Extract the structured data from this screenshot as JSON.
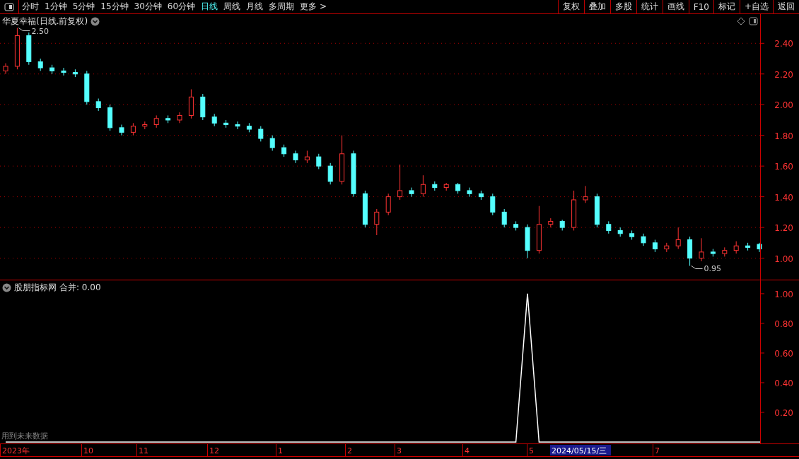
{
  "toolbar": {
    "periods": [
      {
        "label": "分时",
        "selected": false
      },
      {
        "label": "1分钟",
        "selected": false
      },
      {
        "label": "5分钟",
        "selected": false
      },
      {
        "label": "15分钟",
        "selected": false
      },
      {
        "label": "30分钟",
        "selected": false
      },
      {
        "label": "60分钟",
        "selected": false
      },
      {
        "label": "日线",
        "selected": true
      },
      {
        "label": "周线",
        "selected": false
      },
      {
        "label": "月线",
        "selected": false
      },
      {
        "label": "多周期",
        "selected": false
      },
      {
        "label": "更多 >",
        "selected": false
      }
    ],
    "buttons": [
      "复权",
      "叠加",
      "多股",
      "统计",
      "画线",
      "F10",
      "标记",
      "+自选",
      "返回"
    ]
  },
  "price_pane": {
    "title": "华夏幸福(日线.前复权)",
    "chart_data": {
      "type": "candlestick",
      "grid": true,
      "ohlc": [
        [
          2.22,
          2.27,
          2.2,
          2.25
        ],
        [
          2.25,
          2.5,
          2.23,
          2.45
        ],
        [
          2.45,
          2.47,
          2.26,
          2.28
        ],
        [
          2.28,
          2.3,
          2.22,
          2.24
        ],
        [
          2.24,
          2.26,
          2.2,
          2.22
        ],
        [
          2.22,
          2.24,
          2.19,
          2.21
        ],
        [
          2.21,
          2.23,
          2.18,
          2.2
        ],
        [
          2.2,
          2.22,
          2.0,
          2.02
        ],
        [
          2.02,
          2.04,
          1.96,
          1.98
        ],
        [
          1.98,
          2.0,
          1.83,
          1.85
        ],
        [
          1.85,
          1.87,
          1.8,
          1.82
        ],
        [
          1.82,
          1.88,
          1.8,
          1.86
        ],
        [
          1.86,
          1.89,
          1.84,
          1.87
        ],
        [
          1.87,
          1.93,
          1.85,
          1.91
        ],
        [
          1.91,
          1.93,
          1.88,
          1.9
        ],
        [
          1.9,
          1.95,
          1.88,
          1.93
        ],
        [
          1.93,
          2.1,
          1.91,
          2.05
        ],
        [
          2.05,
          2.07,
          1.9,
          1.92
        ],
        [
          1.92,
          1.94,
          1.86,
          1.88
        ],
        [
          1.88,
          1.9,
          1.85,
          1.87
        ],
        [
          1.87,
          1.89,
          1.84,
          1.86
        ],
        [
          1.86,
          1.88,
          1.82,
          1.84
        ],
        [
          1.84,
          1.86,
          1.76,
          1.78
        ],
        [
          1.78,
          1.8,
          1.7,
          1.72
        ],
        [
          1.72,
          1.74,
          1.66,
          1.68
        ],
        [
          1.68,
          1.7,
          1.62,
          1.64
        ],
        [
          1.64,
          1.7,
          1.62,
          1.66
        ],
        [
          1.66,
          1.68,
          1.58,
          1.6
        ],
        [
          1.6,
          1.62,
          1.48,
          1.5
        ],
        [
          1.5,
          1.8,
          1.48,
          1.68
        ],
        [
          1.68,
          1.7,
          1.4,
          1.42
        ],
        [
          1.42,
          1.44,
          1.2,
          1.22
        ],
        [
          1.22,
          1.32,
          1.15,
          1.3
        ],
        [
          1.3,
          1.42,
          1.28,
          1.4
        ],
        [
          1.4,
          1.61,
          1.38,
          1.44
        ],
        [
          1.44,
          1.46,
          1.4,
          1.42
        ],
        [
          1.42,
          1.54,
          1.4,
          1.48
        ],
        [
          1.48,
          1.5,
          1.44,
          1.46
        ],
        [
          1.46,
          1.49,
          1.44,
          1.48
        ],
        [
          1.48,
          1.49,
          1.42,
          1.44
        ],
        [
          1.44,
          1.46,
          1.4,
          1.42
        ],
        [
          1.42,
          1.44,
          1.38,
          1.4
        ],
        [
          1.4,
          1.42,
          1.28,
          1.3
        ],
        [
          1.3,
          1.32,
          1.2,
          1.22
        ],
        [
          1.22,
          1.24,
          1.18,
          1.2
        ],
        [
          1.2,
          1.22,
          1.0,
          1.05
        ],
        [
          1.05,
          1.34,
          1.03,
          1.22
        ],
        [
          1.22,
          1.26,
          1.2,
          1.24
        ],
        [
          1.24,
          1.25,
          1.18,
          1.2
        ],
        [
          1.2,
          1.44,
          1.18,
          1.38
        ],
        [
          1.38,
          1.47,
          1.36,
          1.4
        ],
        [
          1.4,
          1.42,
          1.2,
          1.22
        ],
        [
          1.22,
          1.24,
          1.16,
          1.18
        ],
        [
          1.18,
          1.2,
          1.14,
          1.16
        ],
        [
          1.16,
          1.18,
          1.12,
          1.14
        ],
        [
          1.14,
          1.16,
          1.08,
          1.1
        ],
        [
          1.1,
          1.12,
          1.04,
          1.06
        ],
        [
          1.06,
          1.1,
          1.04,
          1.08
        ],
        [
          1.08,
          1.2,
          1.06,
          1.12
        ],
        [
          1.12,
          1.14,
          0.95,
          1.0
        ],
        [
          1.0,
          1.13,
          0.98,
          1.04
        ],
        [
          1.04,
          1.06,
          1.01,
          1.03
        ],
        [
          1.03,
          1.07,
          1.01,
          1.05
        ],
        [
          1.05,
          1.11,
          1.03,
          1.08
        ],
        [
          1.08,
          1.1,
          1.05,
          1.07
        ],
        [
          1.09,
          1.1,
          1.04,
          1.06
        ]
      ],
      "ylim": [
        0.86,
        2.59
      ],
      "yticks": [
        {
          "value": 2.4,
          "label": "2.40"
        },
        {
          "value": 2.2,
          "label": "2.20"
        },
        {
          "value": 2.0,
          "label": "2.00"
        },
        {
          "value": 1.8,
          "label": "1.80"
        },
        {
          "value": 1.6,
          "label": "1.60"
        },
        {
          "value": 1.4,
          "label": "1.40"
        },
        {
          "value": 1.2,
          "label": "1.20"
        },
        {
          "value": 1.0,
          "label": "1.00"
        }
      ],
      "annotations": [
        "2.50",
        "0.95"
      ]
    }
  },
  "indicator_pane": {
    "title": "股朋指标网",
    "reading": "合并: 0.00",
    "note": "用到未来数据",
    "chart_data": {
      "type": "line",
      "series": [
        {
          "color": "#ffffff",
          "values": [
            0,
            0,
            0,
            0,
            0,
            0,
            0,
            0,
            0,
            0,
            0,
            0,
            0,
            0,
            0,
            0,
            0,
            0,
            0,
            0,
            0,
            0,
            0,
            0,
            0,
            0,
            0,
            0,
            0,
            0,
            0,
            0,
            0,
            0,
            0,
            0,
            0,
            0,
            0,
            0,
            0,
            0,
            0,
            0,
            0,
            1,
            0,
            0,
            0,
            0,
            0,
            0,
            0,
            0,
            0,
            0,
            0,
            0,
            0,
            0,
            0,
            0,
            0,
            0,
            0,
            0
          ]
        }
      ],
      "ylim": [
        0,
        1.09
      ],
      "yticks": [
        {
          "value": 1.0,
          "label": "1.00"
        },
        {
          "value": 0.8,
          "label": "0.80"
        },
        {
          "value": 0.6,
          "label": "0.60"
        },
        {
          "value": 0.4,
          "label": "0.40"
        },
        {
          "value": 0.2,
          "label": "0.20"
        }
      ]
    }
  },
  "time_axis": {
    "labels": [
      "2023年",
      "10",
      "11",
      "12",
      "1",
      "2",
      "3",
      "4",
      "5",
      "7"
    ],
    "cursor": "2024/05/15/三"
  }
}
